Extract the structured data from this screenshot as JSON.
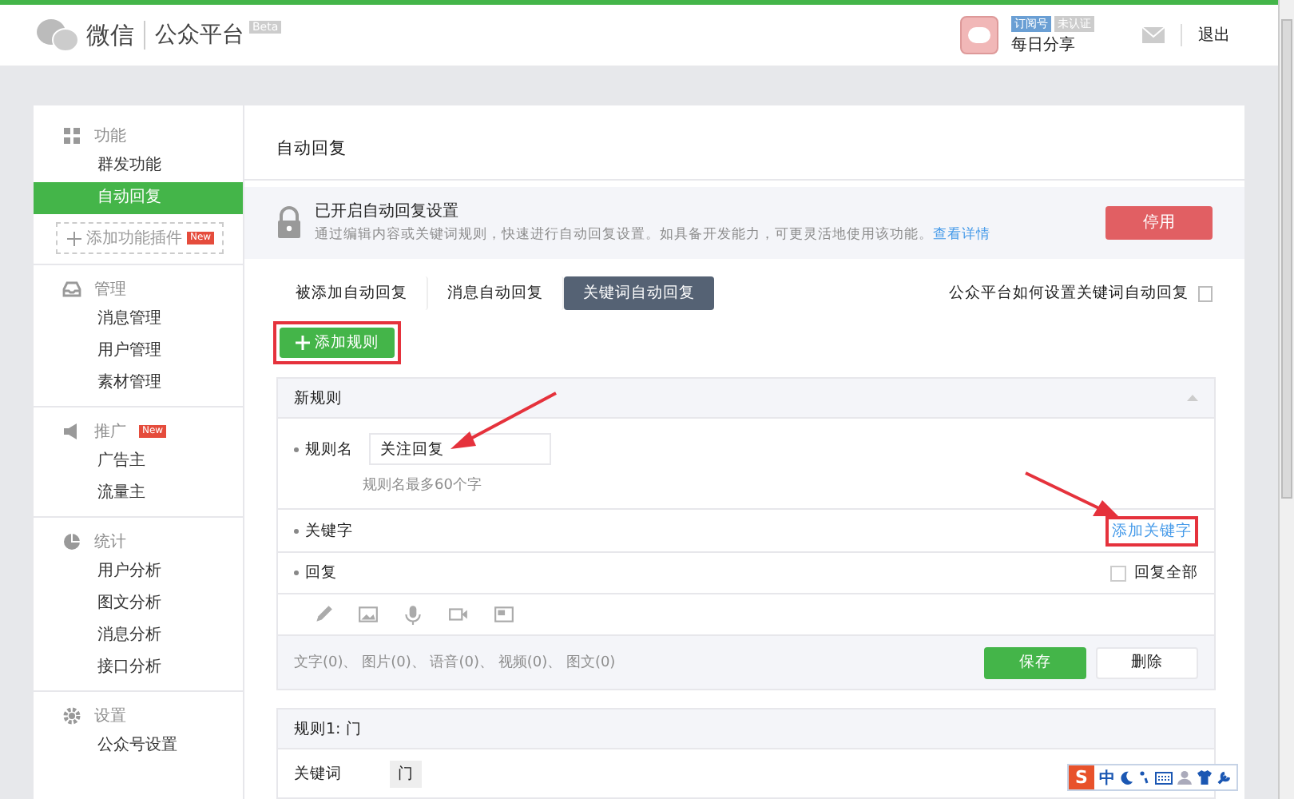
{
  "header": {
    "logo_text": "微信",
    "platform": "公众平台",
    "beta": "Beta",
    "account_badges": [
      {
        "label": "订阅号",
        "kind": "type"
      },
      {
        "label": "未认证",
        "kind": "status"
      }
    ],
    "account_name": "每日分享",
    "logout": "退出"
  },
  "sidebar": {
    "sections": [
      {
        "title": "功能",
        "items": [
          {
            "label": "群发功能",
            "selected": false
          },
          {
            "label": "自动回复",
            "selected": true
          }
        ],
        "add_plugin": {
          "label": "添加功能插件",
          "badge": "New"
        }
      },
      {
        "title": "管理",
        "items": [
          {
            "label": "消息管理",
            "selected": false
          },
          {
            "label": "用户管理",
            "selected": false
          },
          {
            "label": "素材管理",
            "selected": false
          }
        ]
      },
      {
        "title": "推广",
        "badge": "New",
        "items": [
          {
            "label": "广告主",
            "selected": false
          },
          {
            "label": "流量主",
            "selected": false
          }
        ]
      },
      {
        "title": "统计",
        "items": [
          {
            "label": "用户分析",
            "selected": false
          },
          {
            "label": "图文分析",
            "selected": false
          },
          {
            "label": "消息分析",
            "selected": false
          },
          {
            "label": "接口分析",
            "selected": false
          }
        ]
      },
      {
        "title": "设置",
        "items": [
          {
            "label": "公众号设置",
            "selected": false
          }
        ]
      }
    ]
  },
  "content": {
    "title": "自动回复",
    "notice": {
      "title": "已开启自动回复设置",
      "text": "通过编辑内容或关键词规则，快速进行自动回复设置。如具备开发能力，可更灵活地使用该功能。",
      "link": "查看详情",
      "button": "停用"
    },
    "tabs": [
      {
        "label": "被添加自动回复",
        "selected": false
      },
      {
        "label": "消息自动回复",
        "selected": false
      },
      {
        "label": "关键词自动回复",
        "selected": true
      }
    ],
    "help_link": "公众平台如何设置关键词自动回复",
    "add_rule": "添加规则",
    "new_rule": {
      "title": "新规则",
      "name_label": "规则名",
      "name_value": "关注回复",
      "name_hint": "规则名最多60个字",
      "keyword_label": "关键字",
      "add_keyword": "添加关键字",
      "reply_label": "回复",
      "reply_all": {
        "label": "回复全部",
        "checked": false
      },
      "counts": "文字(0)、 图片(0)、 语音(0)、 视频(0)、 图文(0)",
      "save": "保存",
      "delete": "删除"
    },
    "rules": [
      {
        "title": "规则1: 门",
        "keyword_label": "关键词",
        "keywords": [
          "门"
        ]
      }
    ]
  },
  "ime": {
    "logo": "S",
    "mode": "中"
  }
}
